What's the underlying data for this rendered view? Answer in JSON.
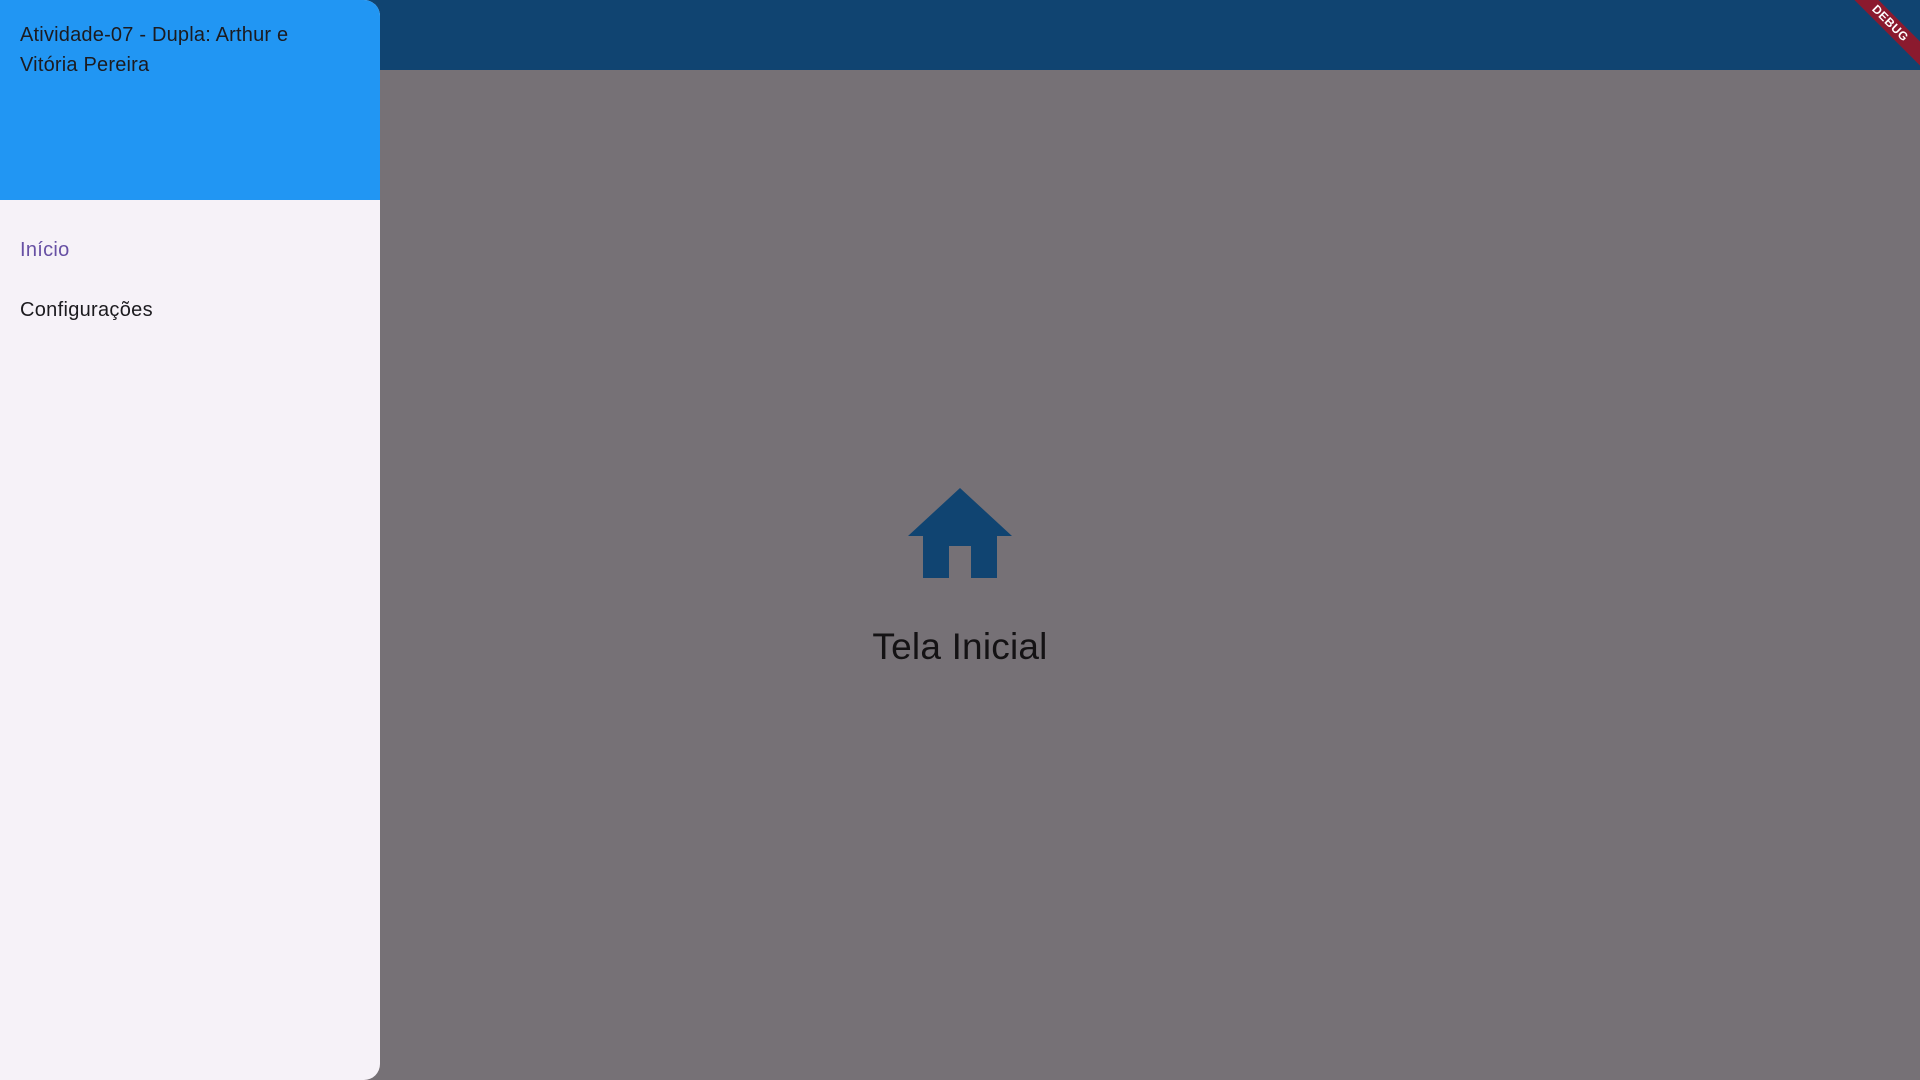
{
  "drawer": {
    "header_title": "Atividade-07 - Dupla: Arthur e Vitória Pereira",
    "items": [
      {
        "label": "Início",
        "selected": true
      },
      {
        "label": "Configurações",
        "selected": false
      }
    ]
  },
  "main": {
    "icon": "home-icon",
    "title": "Tela Inicial"
  },
  "debug_banner": {
    "label": "DEBUG"
  },
  "colors": {
    "appbar": "#104471",
    "scrim_background": "#767176",
    "drawer_header": "#2196f3",
    "drawer_background": "#f6f2f8",
    "selected_item": "#6750a4",
    "home_icon": "#104471",
    "debug_ribbon": "#8b1a2e"
  }
}
